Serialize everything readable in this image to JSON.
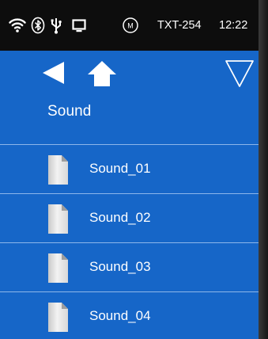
{
  "status_bar": {
    "device_name": "TXT-254",
    "time": "12:22",
    "icons": [
      "wifi-icon",
      "bluetooth-icon",
      "usb-icon",
      "display-icon",
      "m-circle-icon"
    ],
    "m_badge": "M"
  },
  "toolbar": {
    "back": "back-arrow-icon",
    "home": "home-icon",
    "menu": "dropdown-triangle-icon"
  },
  "page": {
    "title": "Sound"
  },
  "files": [
    {
      "label": "Sound_01",
      "icon": "document-icon"
    },
    {
      "label": "Sound_02",
      "icon": "document-icon"
    },
    {
      "label": "Sound_03",
      "icon": "document-icon"
    },
    {
      "label": "Sound_04",
      "icon": "document-icon"
    }
  ],
  "colors": {
    "background": "#1666c8",
    "status_bar": "#0d0d0d",
    "divider": "#8db6ea",
    "text": "#ffffff"
  }
}
